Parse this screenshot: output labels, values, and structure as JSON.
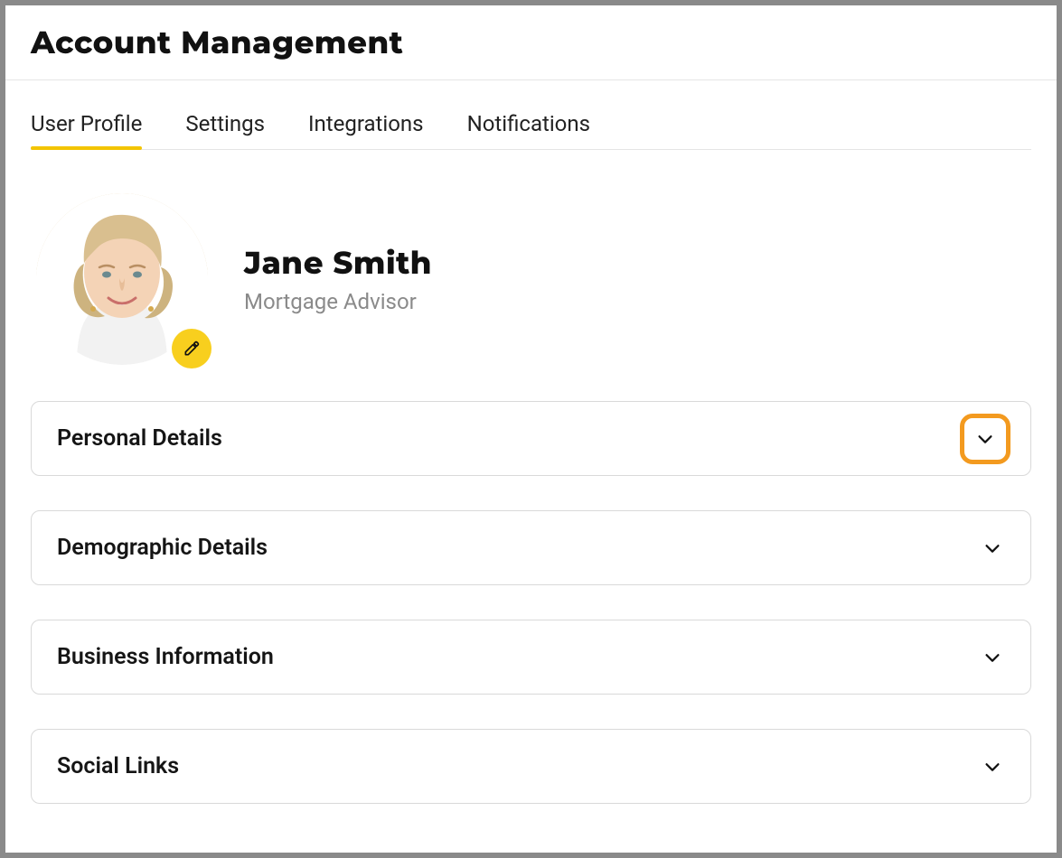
{
  "header": {
    "title": "Account Management"
  },
  "tabs": [
    {
      "label": "User Profile",
      "active": true
    },
    {
      "label": "Settings",
      "active": false
    },
    {
      "label": "Integrations",
      "active": false
    },
    {
      "label": "Notifications",
      "active": false
    }
  ],
  "profile": {
    "name": "Jane Smith",
    "role": "Mortgage Advisor",
    "edit_icon": "edit-icon"
  },
  "sections": [
    {
      "title": "Personal Details",
      "highlight": true
    },
    {
      "title": "Demographic Details",
      "highlight": false
    },
    {
      "title": "Business Information",
      "highlight": false
    },
    {
      "title": "Social Links",
      "highlight": false
    }
  ],
  "colors": {
    "accent_yellow": "#f8cf1e",
    "tab_underline": "#f3c400",
    "highlight_orange": "#f39a1f",
    "border_gray": "#d9d9d9",
    "muted_text": "#8a8a8a"
  }
}
